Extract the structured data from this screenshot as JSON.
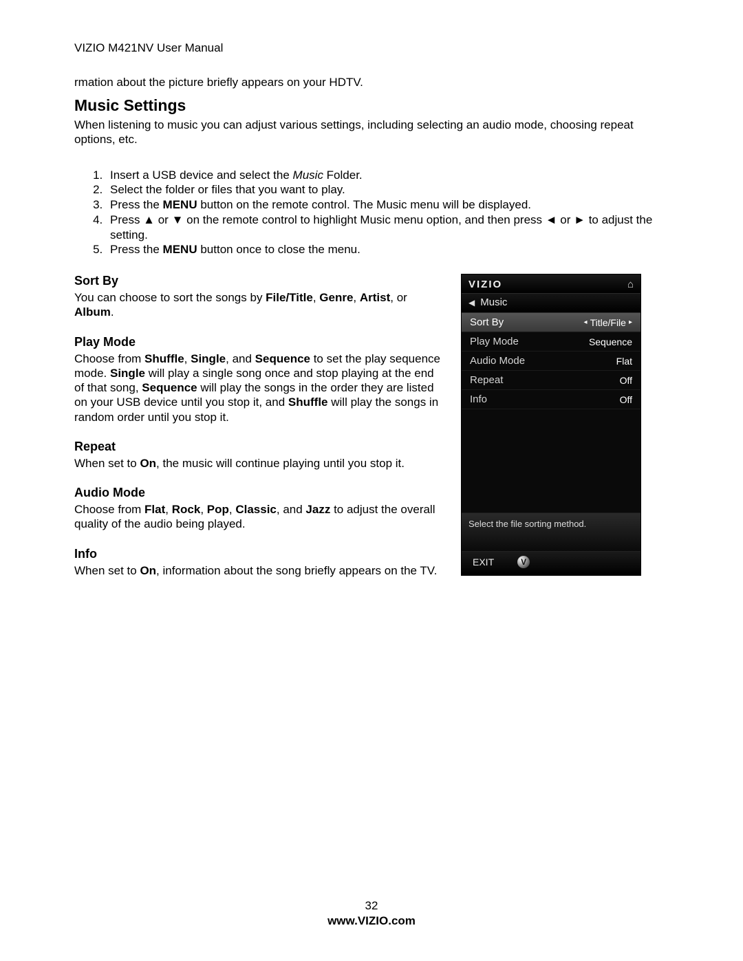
{
  "header": {
    "doc_title": "VIZIO M421NV User Manual"
  },
  "fragment": {
    "text": "rmation about the picture briefly appears on your HDTV."
  },
  "music_settings": {
    "title": "Music Settings",
    "intro": "When listening to music you can adjust various settings, including selecting an audio mode, choosing repeat options, etc.",
    "steps": {
      "s1_pre": "Insert a USB device and select the ",
      "s1_music": "Music",
      "s1_post": " Folder.",
      "s2": "Select the folder or files that you want to play.",
      "s3_pre": "Press the ",
      "s3_menu": "MENU",
      "s3_post": " button on the remote control. The Music menu will be displayed.",
      "s4_pre": "Press ▲ or ▼ on the remote control to highlight Music menu option, and then press ◄ or ► to adjust the setting.",
      "s5_pre": "Press the ",
      "s5_menu": "MENU",
      "s5_post": " button once to close the menu."
    }
  },
  "sections": {
    "sort_by": {
      "title": "Sort By",
      "pre": "You can choose to sort the songs by ",
      "b1": "File/Title",
      "c1": ", ",
      "b2": "Genre",
      "c2": ", ",
      "b3": "Artist",
      "c3": ", or ",
      "b4": "Album",
      "post": "."
    },
    "play_mode": {
      "title": "Play Mode",
      "pre": "Choose from ",
      "b1": "Shuffle",
      "c1": ", ",
      "b2": "Single",
      "c2": ", and ",
      "b3": "Sequence",
      "mid1": " to set the play sequence mode. ",
      "b4": "Single",
      "mid2": " will play a single song once and stop playing at the end of that song, ",
      "b5": "Sequence",
      "mid3": " will play the songs in the order they are listed on your USB device until you stop it, and ",
      "b6": "Shuffle",
      "post": " will play the songs in random order until you stop it."
    },
    "repeat": {
      "title": "Repeat",
      "pre": "When set to ",
      "b1": "On",
      "post": ", the music will continue playing until you stop it."
    },
    "audio_mode": {
      "title": "Audio Mode",
      "pre": "Choose from ",
      "b1": "Flat",
      "c1": ", ",
      "b2": "Rock",
      "c2": ", ",
      "b3": "Pop",
      "c3": ", ",
      "b4": "Classic",
      "c4": ", and ",
      "b5": "Jazz",
      "post": " to adjust the overall quality of the audio being played."
    },
    "info": {
      "title": "Info",
      "pre": "When set to ",
      "b1": "On",
      "post": ", information about the song briefly appears on the TV."
    }
  },
  "tv_menu": {
    "brand": "VIZIO",
    "breadcrumb": "Music",
    "rows": [
      {
        "label": "Sort By",
        "value": "Title/File",
        "selected": true
      },
      {
        "label": "Play Mode",
        "value": "Sequence",
        "selected": false
      },
      {
        "label": "Audio Mode",
        "value": "Flat",
        "selected": false
      },
      {
        "label": "Repeat",
        "value": "Off",
        "selected": false
      },
      {
        "label": "Info",
        "value": "Off",
        "selected": false
      }
    ],
    "hint": "Select the file sorting method.",
    "exit": "EXIT",
    "v_glyph": "V"
  },
  "footer": {
    "page_num": "32",
    "url": "www.VIZIO.com"
  }
}
